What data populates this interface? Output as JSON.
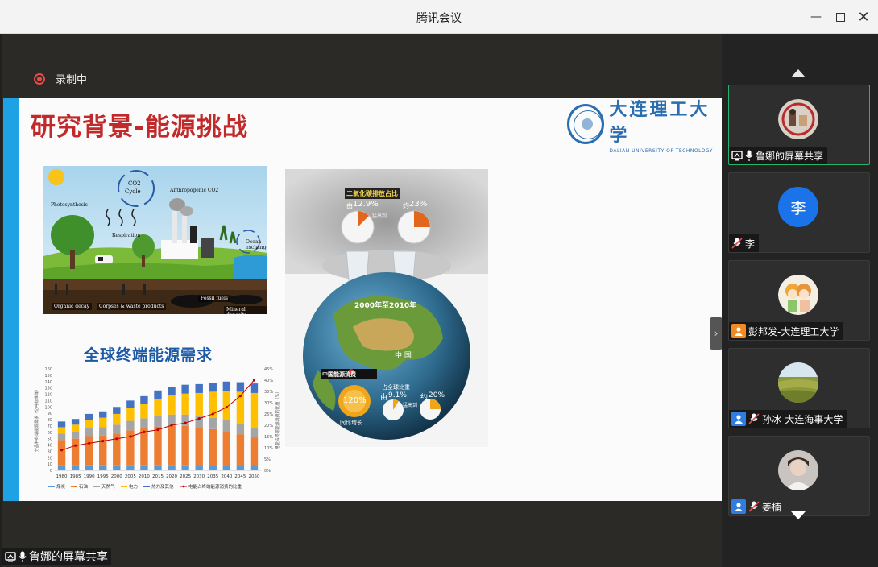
{
  "window": {
    "title": "腾讯会议"
  },
  "recording": {
    "label": "录制中"
  },
  "slide": {
    "title": "研究背景-能源挑战",
    "logo": {
      "name_cn": "大连理工大学",
      "name_en": "DALIAN UNIVERSITY OF TECHNOLOGY"
    },
    "co2_illustration": {
      "labels": [
        "Photosynthesis",
        "CO2 Cycle",
        "Anthropogenic CO2",
        "Respiration",
        "Ocean exchange",
        "Organic decay",
        "Corpses & waste products",
        "Fossil fuels",
        "Mineral deposits"
      ]
    },
    "earth_illustration": {
      "co2_share_title": "二氧化碳排放占比",
      "pie_left_prefix": "由",
      "pie_left_value": "12.9%",
      "pie_right_prefix": "约",
      "pie_right_value": "23%",
      "pie_sub": "猛高到",
      "period": "2000年至2010年",
      "country": "中 国",
      "consumption_label": "中国能源消费",
      "growth_value": "120%",
      "growth_label": "同比增长",
      "global_share_title": "占全球比重",
      "global_from_prefix": "由",
      "global_from": "9.1%",
      "global_to_prefix": "约",
      "global_to": "20%",
      "global_sub": "猛高到"
    }
  },
  "chart_data": {
    "type": "bar",
    "title": "全球终端能源需求",
    "ylabel": "分品种终端能源需求（亿吨标准煤）",
    "y2label": "电能占终端能源消费的比重（%）",
    "categories": [
      "1980",
      "1985",
      "1990",
      "1995",
      "2000",
      "2005",
      "2010",
      "2015",
      "2020",
      "2025",
      "2030",
      "2035",
      "2040",
      "2045",
      "2050"
    ],
    "ylim": [
      0,
      160
    ],
    "y_ticks": [
      "0",
      "10",
      "20",
      "30",
      "40",
      "50",
      "60",
      "70",
      "80",
      "90",
      "100",
      "110",
      "120",
      "130",
      "140",
      "150",
      "160"
    ],
    "y2lim": [
      0,
      45
    ],
    "y2_ticks": [
      "0%",
      "5%",
      "10%",
      "15%",
      "20%",
      "25%",
      "30%",
      "35%",
      "40%",
      "45%"
    ],
    "series": [
      {
        "name": "煤炭",
        "color": "#5b9bd5",
        "values": [
          8,
          8,
          8,
          8,
          8,
          8,
          8,
          8,
          8,
          8,
          7,
          7,
          7,
          7,
          7
        ]
      },
      {
        "name": "石油",
        "color": "#ed7d31",
        "values": [
          40,
          42,
          46,
          47,
          50,
          55,
          58,
          61,
          62,
          62,
          60,
          58,
          55,
          50,
          45
        ]
      },
      {
        "name": "天然气",
        "color": "#a5a5a5",
        "values": [
          10,
          11,
          12,
          13,
          14,
          15,
          16,
          17,
          18,
          18,
          18,
          18,
          17,
          16,
          14
        ]
      },
      {
        "name": "电力",
        "color": "#ffc000",
        "values": [
          10,
          11,
          13,
          15,
          17,
          20,
          23,
          27,
          30,
          33,
          37,
          41,
          46,
          51,
          56
        ]
      },
      {
        "name": "热力及其他",
        "color": "#4472c4",
        "values": [
          9,
          9,
          10,
          10,
          11,
          12,
          12,
          13,
          13,
          14,
          14,
          14,
          15,
          15,
          15
        ]
      },
      {
        "name": "电能占终端能源消费的比重",
        "color": "#c00000",
        "type": "line",
        "axis": "y2",
        "values": [
          9,
          11,
          12,
          13,
          14,
          15,
          17,
          18,
          20,
          21,
          23,
          25,
          28,
          33,
          40
        ]
      }
    ]
  },
  "share": {
    "label": "鲁娜的屏幕共享"
  },
  "participants": [
    {
      "name": "鲁娜的屏幕共享",
      "avatar": "photo-seal",
      "active": true,
      "icon": "screen-share"
    },
    {
      "name": "李",
      "avatar_letter": "李",
      "icon": "mic-muted"
    },
    {
      "name": "彭邦发-大连理工大学",
      "avatar": "cartoon",
      "icon": "person-orange"
    },
    {
      "name": "孙冰-大连海事大学",
      "avatar": "landscape",
      "icon": "person-blue-mic-muted"
    },
    {
      "name": "姜楠",
      "avatar": "portrait",
      "icon": "person-blue-mic-muted"
    }
  ]
}
